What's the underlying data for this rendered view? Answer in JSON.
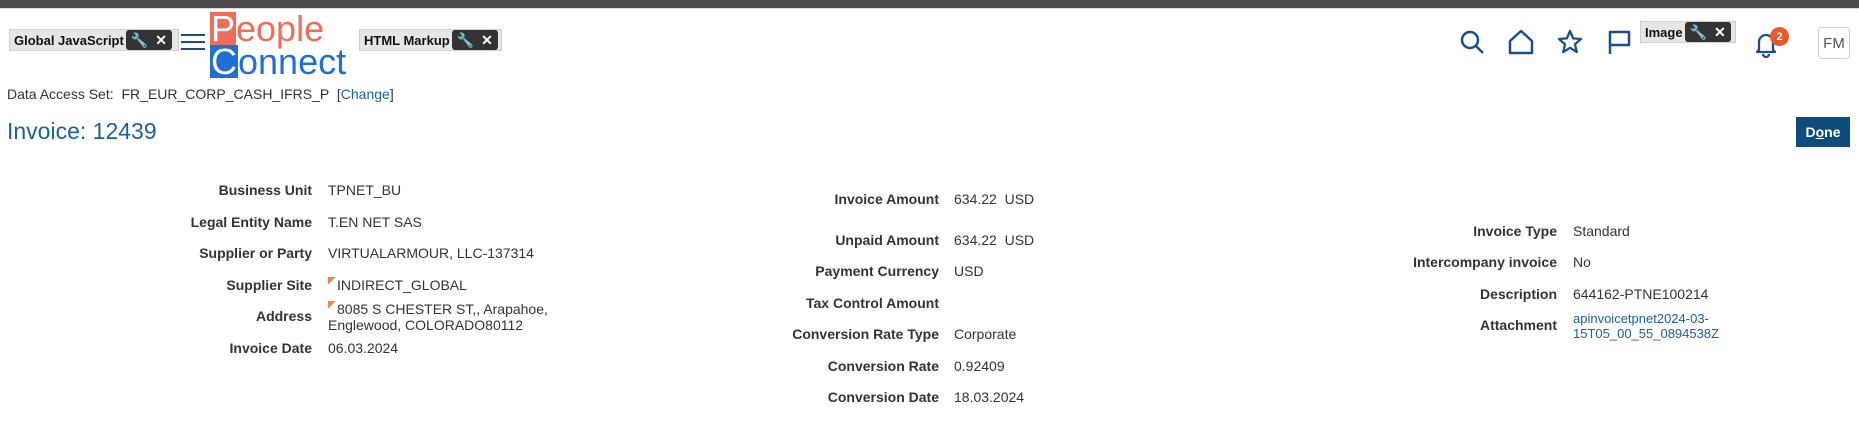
{
  "toolbar": {
    "chips": [
      {
        "label": "Global JavaScript"
      },
      {
        "label": "HTML Markup"
      },
      {
        "label": "Image"
      }
    ],
    "wrench": "🔧",
    "close": "✕"
  },
  "logo": {
    "line1_first": "P",
    "line1_rest": "eople",
    "line2_first": "C",
    "line2_rest": "onnect"
  },
  "nav": {
    "notification_count": "2",
    "avatar_initials": "FM"
  },
  "data_access": {
    "label": "Data Access Set:",
    "value": "FR_EUR_CORP_CASH_IFRS_P",
    "link": "Change"
  },
  "page": {
    "title": "Invoice: 12439",
    "done_prefix": "D",
    "done_underlined": "o",
    "done_suffix": "ne"
  },
  "col1": [
    {
      "label": "Business Unit",
      "value": "TPNET_BU"
    },
    {
      "label": "Legal Entity Name",
      "value": "T.EN NET SAS"
    },
    {
      "label": "Supplier or Party",
      "value": "VIRTUALARMOUR, LLC-137314"
    },
    {
      "label": "Supplier Site",
      "value": "INDIRECT_GLOBAL"
    },
    {
      "label": "Address",
      "value": "8085 S CHESTER ST,, Arapahoe,",
      "value2": "Englewood, COLORADO80112"
    },
    {
      "label": "Invoice Date",
      "value": "06.03.2024"
    }
  ],
  "col2": [
    {
      "label": "Invoice Amount",
      "value": "634.22  USD"
    },
    {
      "label": "Unpaid Amount",
      "value": "634.22  USD"
    },
    {
      "label": "Payment Currency",
      "value": "USD"
    },
    {
      "label": "Tax Control Amount",
      "value": ""
    },
    {
      "label": "Conversion Rate Type",
      "value": "Corporate"
    },
    {
      "label": "Conversion Rate",
      "value": "0.92409"
    },
    {
      "label": "Conversion Date",
      "value": "18.03.2024"
    }
  ],
  "col3": [
    {
      "label": "Invoice Type",
      "value": "Standard"
    },
    {
      "label": "Intercompany invoice",
      "value": "No"
    },
    {
      "label": "Description",
      "value": "644162-PTNE100214"
    },
    {
      "label": "Attachment",
      "value": "apinvoicetpnet2024-03-",
      "value2": "15T05_00_55_0894538Z"
    }
  ]
}
